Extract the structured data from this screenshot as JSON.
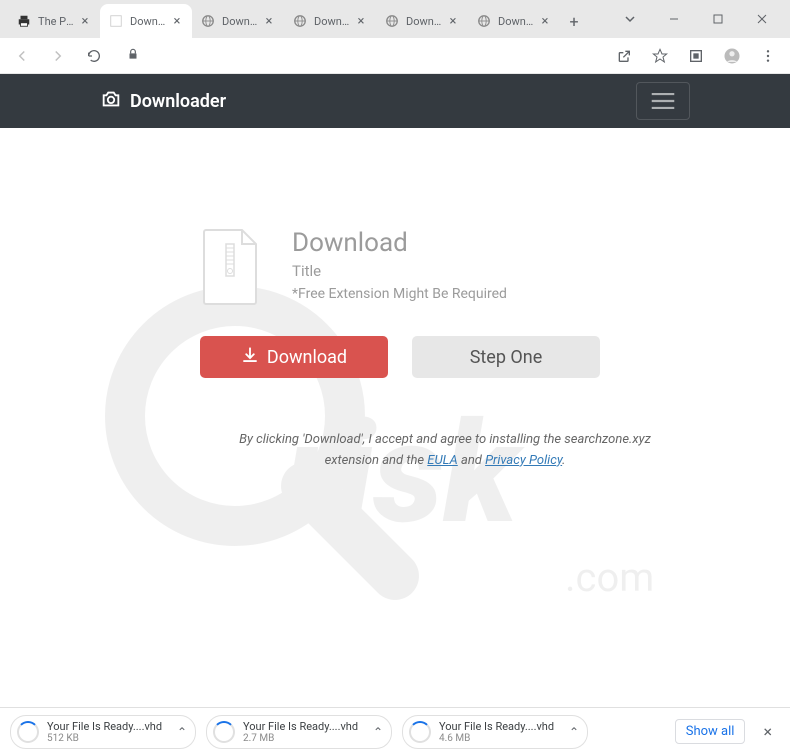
{
  "tabs": [
    {
      "title": "The Pira",
      "active": false,
      "icon": "printer"
    },
    {
      "title": "Downlo",
      "active": true,
      "icon": "blank"
    },
    {
      "title": "Downlo",
      "active": false,
      "icon": "globe"
    },
    {
      "title": "Downlo",
      "active": false,
      "icon": "globe"
    },
    {
      "title": "Downlo",
      "active": false,
      "icon": "globe"
    },
    {
      "title": "Downlo",
      "active": false,
      "icon": "globe"
    }
  ],
  "brand": {
    "name": "Downloader"
  },
  "download": {
    "heading": "Download",
    "title": "Title",
    "note": "*Free Extension Might Be Required",
    "download_btn": "Download",
    "step_btn": "Step One"
  },
  "legal": {
    "text1": "By clicking 'Download', I accept and agree to installing the searchzone.xyz",
    "text2_a": "extension and the ",
    "eula": "EULA",
    "and": " and ",
    "privacy": "Privacy Policy",
    "period": "."
  },
  "shelf": {
    "items": [
      {
        "name": "Your File Is Ready....vhd",
        "size": "512 KB"
      },
      {
        "name": "Your File Is Ready....vhd",
        "size": "2.7 MB"
      },
      {
        "name": "Your File Is Ready....vhd",
        "size": "4.6 MB"
      }
    ],
    "show_all": "Show all"
  }
}
